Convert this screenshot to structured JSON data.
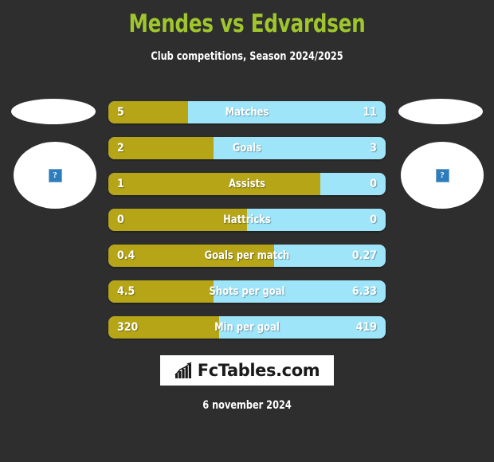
{
  "header": {
    "title": "Mendes vs Edvardsen",
    "subtitle": "Club competitions, Season 2024/2025",
    "title_color": "#9fc62d"
  },
  "players": {
    "left": {
      "placeholder_icon": "broken-image-icon",
      "placeholder_glyph": "?"
    },
    "right": {
      "placeholder_icon": "broken-image-icon",
      "placeholder_glyph": "?"
    }
  },
  "colors": {
    "background": "#2e2e2e",
    "home_bar": "#b5a517",
    "away_bar": "#9fe5fa",
    "text": "#ffffff"
  },
  "chart_data": {
    "type": "bar",
    "title": "Mendes vs Edvardsen",
    "subtitle": "Club competitions, Season 2024/2025",
    "orientation": "horizontal-diverging",
    "series": [
      {
        "name": "Mendes",
        "color": "#b5a517"
      },
      {
        "name": "Edvardsen",
        "color": "#9fe5fa"
      }
    ],
    "categories": [
      "Matches",
      "Goals",
      "Assists",
      "Hattricks",
      "Goals per match",
      "Shots per goal",
      "Min per goal"
    ],
    "rows": [
      {
        "label": "Matches",
        "left_value": "5",
        "right_value": "11",
        "left_pct": 28.7
      },
      {
        "label": "Goals",
        "left_value": "2",
        "right_value": "3",
        "left_pct": 38.0
      },
      {
        "label": "Assists",
        "left_value": "1",
        "right_value": "0",
        "left_pct": 76.5
      },
      {
        "label": "Hattricks",
        "left_value": "0",
        "right_value": "0",
        "left_pct": 50.0
      },
      {
        "label": "Goals per match",
        "left_value": "0.4",
        "right_value": "0.27",
        "left_pct": 59.7
      },
      {
        "label": "Shots per goal",
        "left_value": "4.5",
        "right_value": "6.33",
        "left_pct": 38.0
      },
      {
        "label": "Min per goal",
        "left_value": "320",
        "right_value": "419",
        "left_pct": 40.0
      }
    ],
    "grid": false,
    "legend": "none"
  },
  "footer": {
    "logo_icon": "bar-chart-icon",
    "logo_text": "FcTables.com",
    "date": "6 november 2024"
  }
}
